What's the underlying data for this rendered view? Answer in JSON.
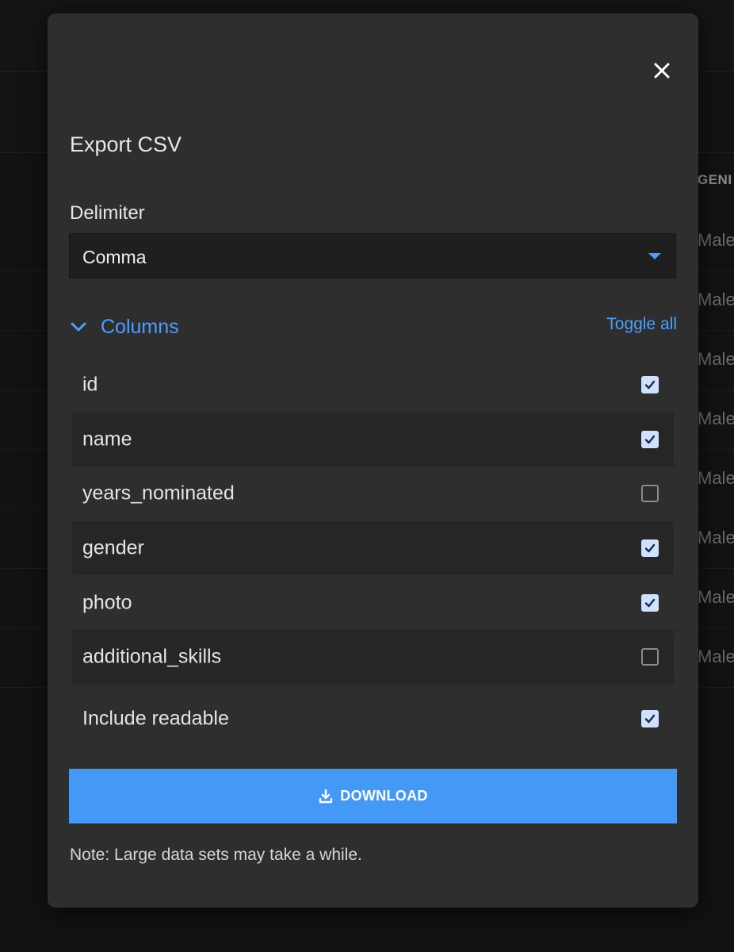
{
  "background": {
    "column_header": "GENI",
    "row_values": [
      "Male",
      "Male",
      "Male",
      "Male",
      "Male",
      "Male",
      "Male",
      "Male"
    ]
  },
  "modal": {
    "title": "Export CSV",
    "close_icon": "close-icon",
    "delimiter": {
      "label": "Delimiter",
      "selected": "Comma"
    },
    "columns": {
      "label": "Columns",
      "toggle_all_label": "Toggle all",
      "items": [
        {
          "name": "id",
          "checked": true
        },
        {
          "name": "name",
          "checked": true
        },
        {
          "name": "years_nominated",
          "checked": false
        },
        {
          "name": "gender",
          "checked": true
        },
        {
          "name": "photo",
          "checked": true
        },
        {
          "name": "additional_skills",
          "checked": false
        }
      ]
    },
    "include_readable": {
      "label": "Include readable",
      "checked": true
    },
    "download": {
      "label": "DOWNLOAD",
      "icon": "download-icon"
    },
    "note": "Note: Large data sets may take a while."
  },
  "colors": {
    "accent": "#4a9eff",
    "button": "#4499f7",
    "modal_bg": "#2e2e2e",
    "checkbox_on": "#cfe1ff"
  }
}
